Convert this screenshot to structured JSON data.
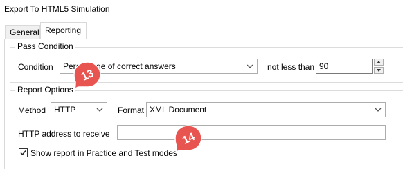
{
  "window": {
    "title": "Export To HTML5 Simulation"
  },
  "tabs": [
    {
      "label": "General",
      "active": false
    },
    {
      "label": "Reporting",
      "active": true
    }
  ],
  "pass_condition": {
    "group_label": "Pass Condition",
    "condition_label": "Condition",
    "condition_value": "Percentage of correct answers",
    "not_less_than_label": "not less than",
    "not_less_than_value": "90"
  },
  "report_options": {
    "group_label": "Report Options",
    "method_label": "Method",
    "method_value": "HTTP",
    "format_label": "Format",
    "format_value": "XML Document",
    "http_address_label": "HTTP address to receive",
    "http_address_value": "",
    "show_report_label": "Show report in Practice and Test modes",
    "show_report_checked": true
  },
  "callouts": [
    {
      "number": "13",
      "color": "#e8544f"
    },
    {
      "number": "14",
      "color": "#e8544f"
    }
  ]
}
